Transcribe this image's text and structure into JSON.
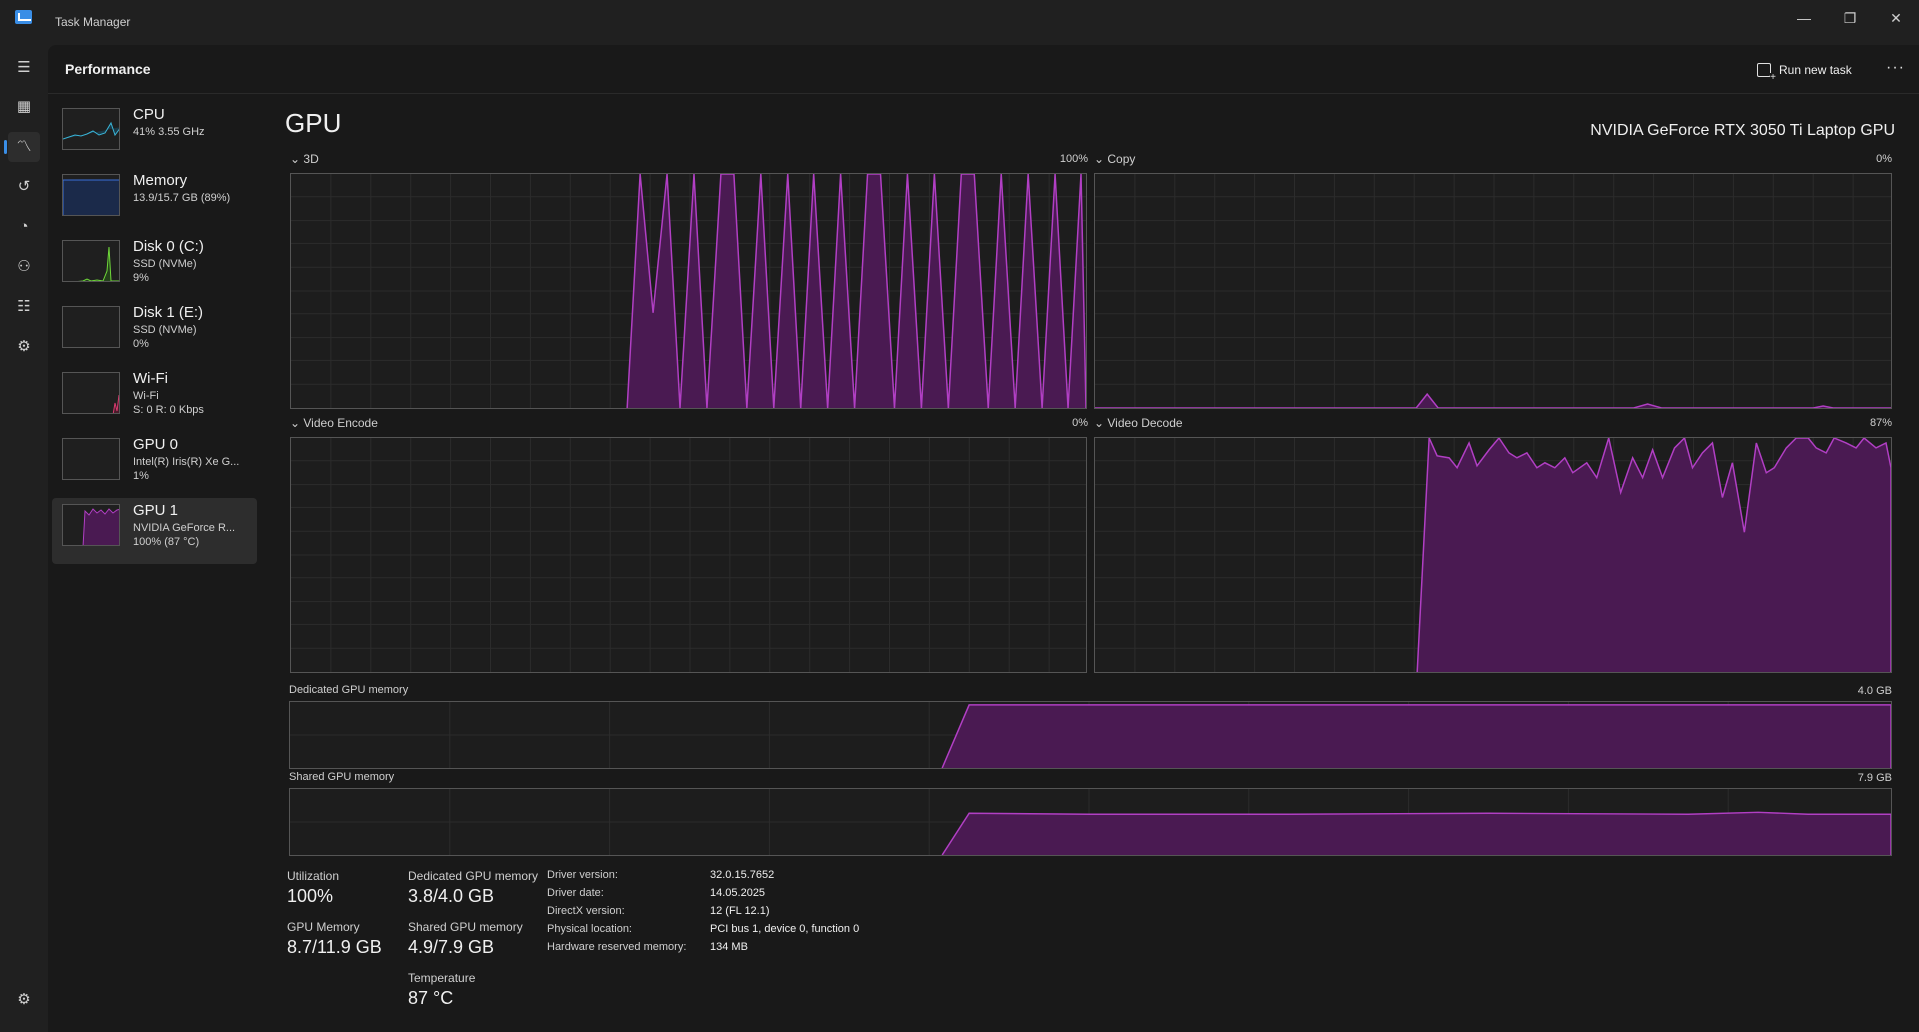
{
  "window": {
    "title": "Task Manager",
    "minimize": "—",
    "maximize": "❐",
    "close": "✕"
  },
  "header": {
    "title": "Performance",
    "run_new_task": "Run new task",
    "more": "···"
  },
  "colors": {
    "accent": "#3a8ee6",
    "gpu_line": "#b13fc4",
    "gpu_fill": "#4a1a52"
  },
  "nav": {
    "icons": [
      "hamburger-icon",
      "processes-icon",
      "performance-icon",
      "app-history-icon",
      "startup-apps-icon",
      "users-icon",
      "details-icon",
      "services-icon",
      "settings-icon"
    ]
  },
  "devices": [
    {
      "name": "CPU",
      "sub1": "41% 3.55 GHz",
      "sub2": "",
      "sub3": ""
    },
    {
      "name": "Memory",
      "sub1": "13.9/15.7 GB (89%)",
      "sub2": "",
      "sub3": ""
    },
    {
      "name": "Disk 0 (C:)",
      "sub1": "SSD (NVMe)",
      "sub2": "9%",
      "sub3": ""
    },
    {
      "name": "Disk 1 (E:)",
      "sub1": "SSD (NVMe)",
      "sub2": "0%",
      "sub3": ""
    },
    {
      "name": "Wi-Fi",
      "sub1": "Wi-Fi",
      "sub2": "S: 0 R: 0 Kbps",
      "sub3": ""
    },
    {
      "name": "GPU 0",
      "sub1": "Intel(R) Iris(R) Xe G...",
      "sub2": "1%",
      "sub3": ""
    },
    {
      "name": "GPU 1",
      "sub1": "NVIDIA GeForce R...",
      "sub2": "100% (87 °C)",
      "sub3": ""
    }
  ],
  "gpu": {
    "title": "GPU",
    "model": "NVIDIA GeForce RTX 3050 Ti Laptop GPU",
    "engines": [
      {
        "label": "3D",
        "pct": "100%"
      },
      {
        "label": "Copy",
        "pct": "0%"
      },
      {
        "label": "Video Encode",
        "pct": "0%"
      },
      {
        "label": "Video Decode",
        "pct": "87%"
      }
    ],
    "dedicated": {
      "label": "Dedicated GPU memory",
      "max": "4.0 GB"
    },
    "shared": {
      "label": "Shared GPU memory",
      "max": "7.9 GB"
    }
  },
  "stats": {
    "utilization_label": "Utilization",
    "utilization": "100%",
    "dedicated_label": "Dedicated GPU memory",
    "dedicated": "3.8/4.0 GB",
    "gpu_memory_label": "GPU Memory",
    "gpu_memory": "8.7/11.9 GB",
    "shared_label": "Shared GPU memory",
    "shared": "4.9/7.9 GB",
    "temperature_label": "Temperature",
    "temperature": "87 °C"
  },
  "info": [
    {
      "label": "Driver version:",
      "value": "32.0.15.7652"
    },
    {
      "label": "Driver date:",
      "value": "14.05.2025"
    },
    {
      "label": "DirectX version:",
      "value": "12 (FL 12.1)"
    },
    {
      "label": "Physical location:",
      "value": "PCI bus 1, device 0, function 0"
    },
    {
      "label": "Hardware reserved memory:",
      "value": "134 MB"
    }
  ]
}
